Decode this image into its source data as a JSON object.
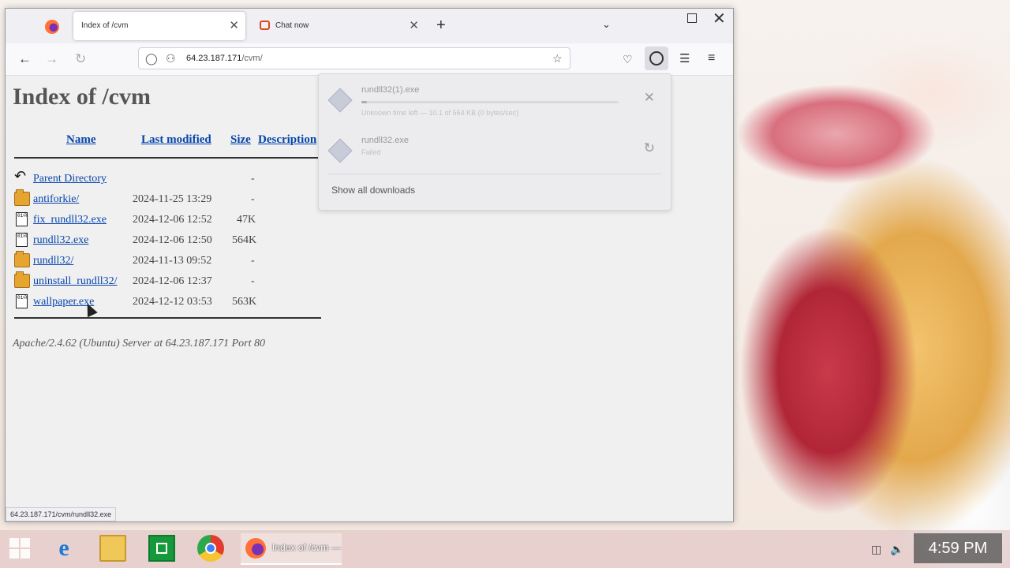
{
  "tabs": [
    {
      "title": "Index of /cvm",
      "active": true
    },
    {
      "title": "Chat now",
      "active": false
    }
  ],
  "tabbar": {
    "new_tab": "+",
    "close_glyph": "✕"
  },
  "nav": {
    "url_host": "64.23.187.171",
    "url_path": "/cvm/"
  },
  "page": {
    "heading": "Index of /cvm",
    "columns": {
      "name": "Name",
      "modified": "Last modified",
      "size": "Size",
      "description": "Description"
    },
    "entries": [
      {
        "name": "Parent Directory",
        "date": "",
        "size": "-",
        "icon": "back-icon"
      },
      {
        "name": "antiforkie/",
        "date": "2024-11-25 13:29",
        "size": "-",
        "icon": "folder-icon"
      },
      {
        "name": "fix_rundll32.exe",
        "date": "2024-12-06 12:52",
        "size": "47K",
        "icon": "file-icon"
      },
      {
        "name": "rundll32.exe",
        "date": "2024-12-06 12:50",
        "size": "564K",
        "icon": "file-icon"
      },
      {
        "name": "rundll32/",
        "date": "2024-11-13 09:52",
        "size": "-",
        "icon": "folder-icon"
      },
      {
        "name": "uninstall_rundll32/",
        "date": "2024-12-06 12:37",
        "size": "-",
        "icon": "folder-icon"
      },
      {
        "name": "wallpaper.exe",
        "date": "2024-12-12 03:53",
        "size": "563K",
        "icon": "file-icon"
      }
    ],
    "server_signature": "Apache/2.4.62 (Ubuntu) Server at 64.23.187.171 Port 80"
  },
  "status_bar": "64.23.187.171/cvm/rundll32.exe",
  "downloads": {
    "items": [
      {
        "name": "rundll32(1).exe",
        "status": "Unknown time left — 10.1 of 564 KB (0 bytes/sec)",
        "progress": 0.02,
        "action_icon": "cancel-icon"
      },
      {
        "name": "rundll32.exe",
        "status": "Failed",
        "progress": null,
        "action_icon": "retry-icon"
      }
    ],
    "show_all": "Show all downloads"
  },
  "taskbar": {
    "firefox_label": "Index of /cvm —",
    "clock": "4:59 PM"
  },
  "colors": {
    "link": "#0645ad",
    "heading": "#555555",
    "firefox_orange": "#ff7139"
  }
}
